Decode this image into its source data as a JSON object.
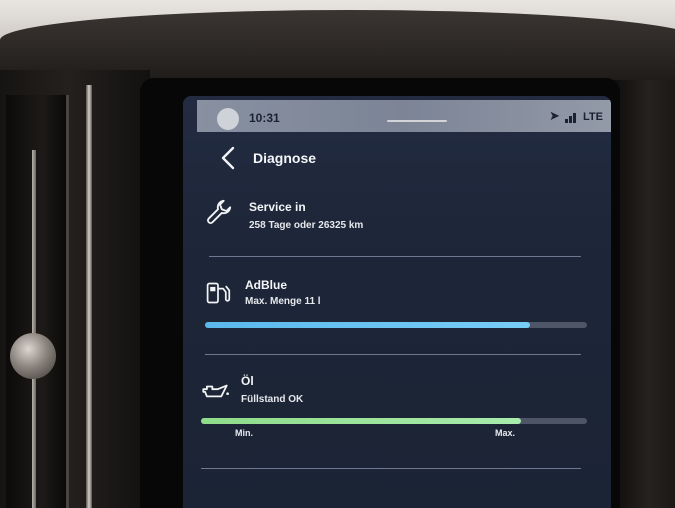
{
  "status_bar": {
    "time": "10:31",
    "network": "LTE",
    "icons": [
      "location-arrow-icon",
      "signal-icon"
    ]
  },
  "header": {
    "title": "Diagnose",
    "back_icon": "chevron-left-icon"
  },
  "items": [
    {
      "icon": "wrench-icon",
      "title": "Service in",
      "subtitle": "258 Tage oder 26325 km"
    },
    {
      "icon": "adblue-pump-icon",
      "title": "AdBlue",
      "subtitle": "Max. Menge 11 l",
      "level": 0.85,
      "bar_color": "#6cc4f2"
    },
    {
      "icon": "oil-can-icon",
      "title": "Öl",
      "subtitle": "Füllstand OK",
      "level": 0.83,
      "min_label": "Min.",
      "max_label": "Max.",
      "bar_color": "#9fe6a0"
    }
  ],
  "colors": {
    "screen_bg": "#1d2638",
    "divider": "#6f7890"
  }
}
